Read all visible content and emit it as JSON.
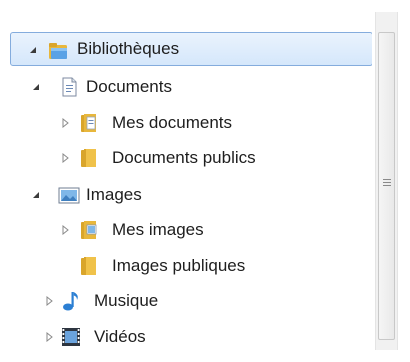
{
  "tree": {
    "items": [
      {
        "label": "Bibliothèques",
        "icon": "library-folder-icon",
        "expanded": true,
        "selected": true
      },
      {
        "label": "Documents",
        "icon": "documents-library-icon",
        "expanded": true
      },
      {
        "label": "Mes documents",
        "icon": "folder-documents-icon",
        "expanded": false
      },
      {
        "label": "Documents publics",
        "icon": "folder-icon",
        "expanded": false
      },
      {
        "label": "Images",
        "icon": "images-library-icon",
        "expanded": true
      },
      {
        "label": "Mes images",
        "icon": "folder-images-icon",
        "expanded": false
      },
      {
        "label": "Images publiques",
        "icon": "folder-icon",
        "expanded": null
      },
      {
        "label": "Musique",
        "icon": "music-library-icon",
        "expanded": false
      },
      {
        "label": "Vidéos",
        "icon": "videos-library-icon",
        "expanded": false
      }
    ]
  },
  "colors": {
    "selection_border": "#84acdd",
    "selection_fill": "#d5e7fb",
    "folder": "#e8b73c"
  }
}
